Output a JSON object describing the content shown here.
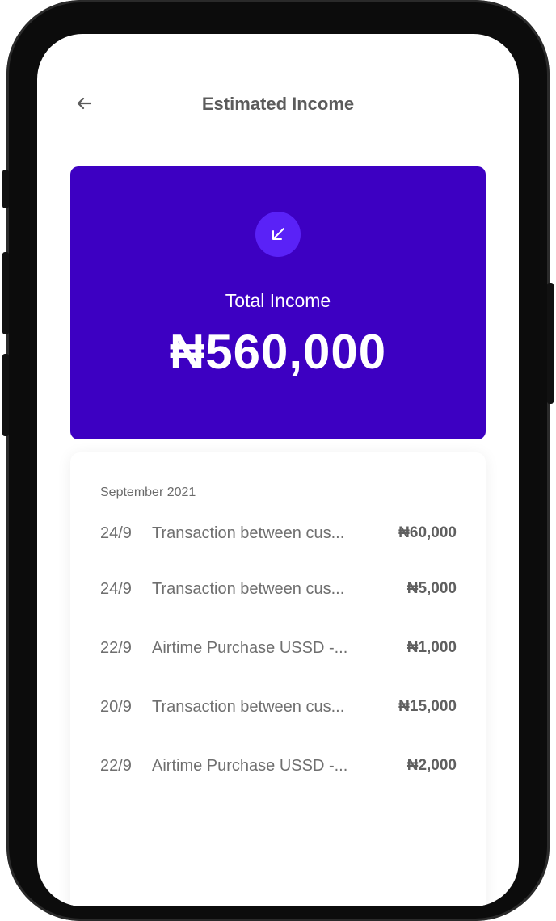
{
  "header": {
    "title": "Estimated Income"
  },
  "summary": {
    "icon": "arrow-down-left-icon",
    "label": "Total Income",
    "amount": "₦560,000",
    "background_color": "#3d00c2",
    "icon_bg_color": "#5a22f7"
  },
  "transactions": {
    "month": "September 2021",
    "items": [
      {
        "date": "24/9",
        "description": "Transaction between cus...",
        "amount": "₦60,000"
      },
      {
        "date": "24/9",
        "description": "Transaction between cus...",
        "amount": "₦5,000"
      },
      {
        "date": "22/9",
        "description": "Airtime Purchase USSD -...",
        "amount": "₦1,000"
      },
      {
        "date": "20/9",
        "description": "Transaction between cus...",
        "amount": "₦15,000"
      },
      {
        "date": "22/9",
        "description": "Airtime Purchase USSD -...",
        "amount": "₦2,000"
      }
    ]
  }
}
